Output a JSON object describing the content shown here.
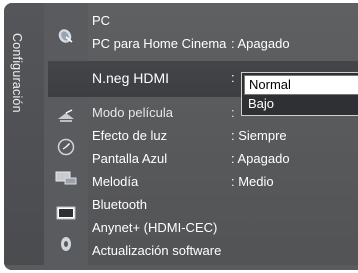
{
  "sidebar": {
    "title": "Configuración"
  },
  "menu": {
    "items": [
      {
        "label": "PC",
        "value": ""
      },
      {
        "label": "PC para Home Cinema",
        "value": ": Apagado"
      },
      {
        "label": "N.neg HDMI",
        "value": ":"
      },
      {
        "label": "Modo película",
        "value": ":"
      },
      {
        "label": "Efecto de luz",
        "value": ": Siempre"
      },
      {
        "label": "Pantalla Azul",
        "value": ": Apagado"
      },
      {
        "label": "Melodía",
        "value": ": Medio"
      },
      {
        "label": "Bluetooth",
        "value": ""
      },
      {
        "label": "Anynet+ (HDMI-CEC)",
        "value": ""
      },
      {
        "label": "Actualización software",
        "value": ""
      }
    ]
  },
  "dropdown": {
    "options": [
      "Normal",
      "Bajo"
    ],
    "selected": "Normal"
  },
  "icons": [
    "satellite-dish-icon",
    "gear-settings-icon",
    "antenna-channel-icon",
    "clock-icon",
    "monitor-keyboard-icon",
    "screen-icon",
    "disc-icon"
  ]
}
